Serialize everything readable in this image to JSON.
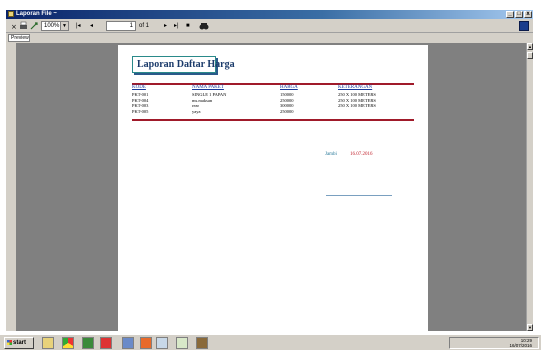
{
  "window": {
    "title": "Laporan File ~",
    "min_label": "_",
    "max_label": "□",
    "close_label": "x"
  },
  "toolbar": {
    "zoom": "100%",
    "page_value": "1",
    "page_of": "of 1"
  },
  "tab": {
    "label": "Preview"
  },
  "report": {
    "title": "Laporan Daftar Harga",
    "columns": [
      "KODE",
      "NAMA PAKET",
      "HARGA",
      "KETERANGAN"
    ],
    "rows": [
      [
        "PKT-001",
        "SINGLE 1 PAPAN",
        "150000",
        "250 X 100 METERS"
      ],
      [
        "PKT-004",
        "ms.maksan",
        "250000",
        "250 X 100 METERS"
      ],
      [
        "PKT-003",
        "rear",
        "300000",
        "250 X 100 METERS"
      ],
      [
        "PKT-005",
        "yaya",
        "250000",
        ""
      ]
    ],
    "sign_place": "Jambi",
    "sign_date": "16.07.2016"
  },
  "taskbar": {
    "start_label": "start",
    "clock_time": "10:29",
    "clock_date": "16/07/2016"
  },
  "colors": {
    "titlebar": "#0a246a",
    "viewer_bg": "#808080",
    "rule": "#a01a2a",
    "header_text": "#1a3a9a"
  }
}
